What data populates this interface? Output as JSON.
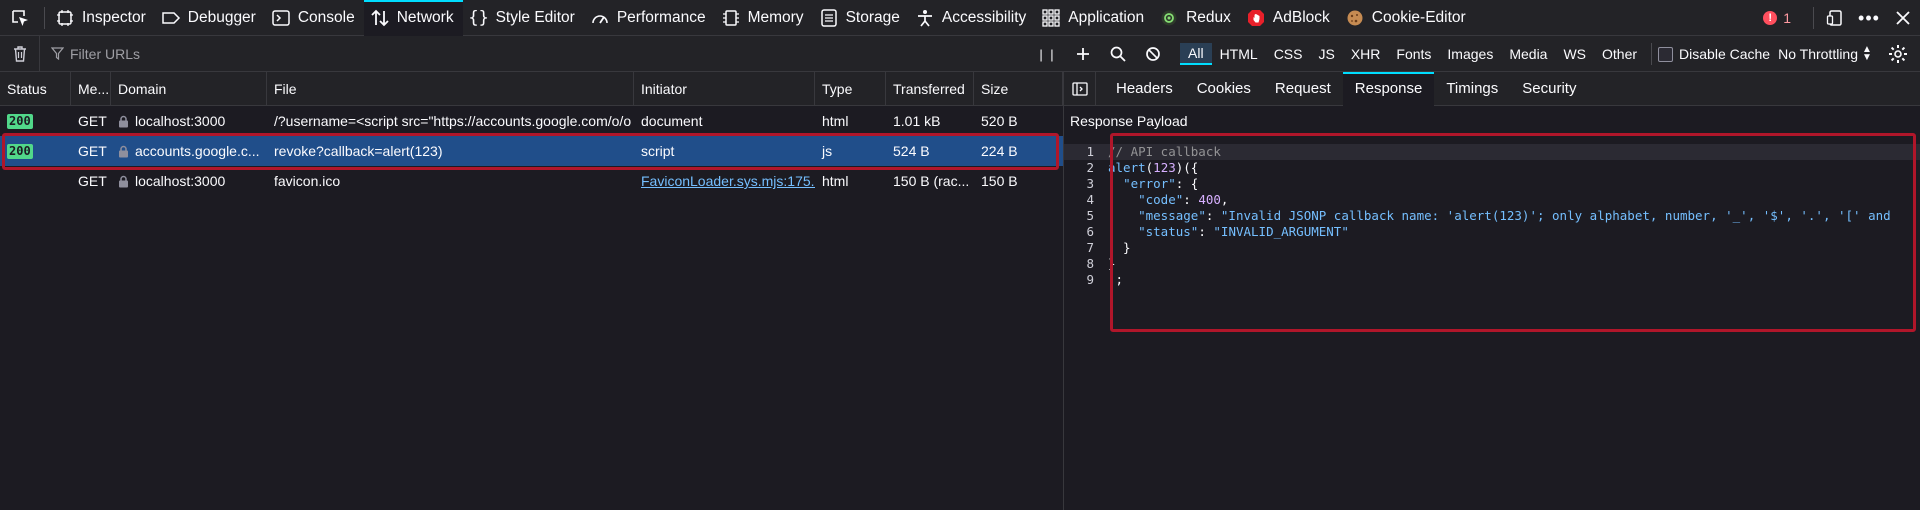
{
  "toolbar": {
    "tabs": [
      {
        "label": "Inspector",
        "icon": "inspector-icon"
      },
      {
        "label": "Debugger",
        "icon": "debugger-icon"
      },
      {
        "label": "Console",
        "icon": "console-icon"
      },
      {
        "label": "Network",
        "icon": "network-icon",
        "active": true
      },
      {
        "label": "Style Editor",
        "icon": "style-editor-icon"
      },
      {
        "label": "Performance",
        "icon": "performance-icon"
      },
      {
        "label": "Memory",
        "icon": "memory-icon"
      },
      {
        "label": "Storage",
        "icon": "storage-icon"
      },
      {
        "label": "Accessibility",
        "icon": "accessibility-icon"
      },
      {
        "label": "Application",
        "icon": "application-icon"
      },
      {
        "label": "Redux",
        "icon": "redux-icon"
      },
      {
        "label": "AdBlock",
        "icon": "adblock-icon"
      },
      {
        "label": "Cookie-Editor",
        "icon": "cookie-icon"
      }
    ],
    "error_count": "1"
  },
  "filterbar": {
    "filter_placeholder": "Filter URLs",
    "types": [
      "All",
      "HTML",
      "CSS",
      "JS",
      "XHR",
      "Fonts",
      "Images",
      "Media",
      "WS",
      "Other"
    ],
    "disable_cache_label": "Disable Cache",
    "throttling_label": "No Throttling"
  },
  "table": {
    "columns": [
      "Status",
      "Me...",
      "Domain",
      "File",
      "Initiator",
      "Type",
      "Transferred",
      "Size"
    ],
    "rows": [
      {
        "status": "200",
        "method": "GET",
        "domain": "localhost:3000",
        "file": "/?username=<script src=\"https://accounts.google.com/o/o",
        "initiator": "document",
        "type": "html",
        "transferred": "1.01 kB",
        "size": "520 B"
      },
      {
        "status": "200",
        "method": "GET",
        "domain": "accounts.google.c...",
        "file": "revoke?callback=alert(123)",
        "initiator": "script",
        "type": "js",
        "transferred": "524 B",
        "size": "224 B",
        "selected": true
      },
      {
        "status": "",
        "method": "GET",
        "domain": "localhost:3000",
        "file": "favicon.ico",
        "initiator": "FaviconLoader.sys.mjs:175...",
        "type": "html",
        "transferred": "150 B (rac...",
        "size": "150 B"
      }
    ]
  },
  "details": {
    "tabs": [
      "Headers",
      "Cookies",
      "Request",
      "Response",
      "Timings",
      "Security"
    ],
    "active_tab": "Response",
    "payload_title": "Response Payload",
    "code_lines": [
      "// API callback",
      "alert(123)({",
      "  \"error\": {",
      "    \"code\": 400,",
      "    \"message\": \"Invalid JSONP callback name: 'alert(123)'; only alphabet, number, '_', '$', '.', '[' and",
      "    \"status\": \"INVALID_ARGUMENT\"",
      "  }",
      "}",
      ");"
    ]
  },
  "colors": {
    "accent": "#00ddff",
    "selected_row": "#204e8a",
    "highlight": "#b0162a",
    "status_ok": "#51d88a"
  }
}
